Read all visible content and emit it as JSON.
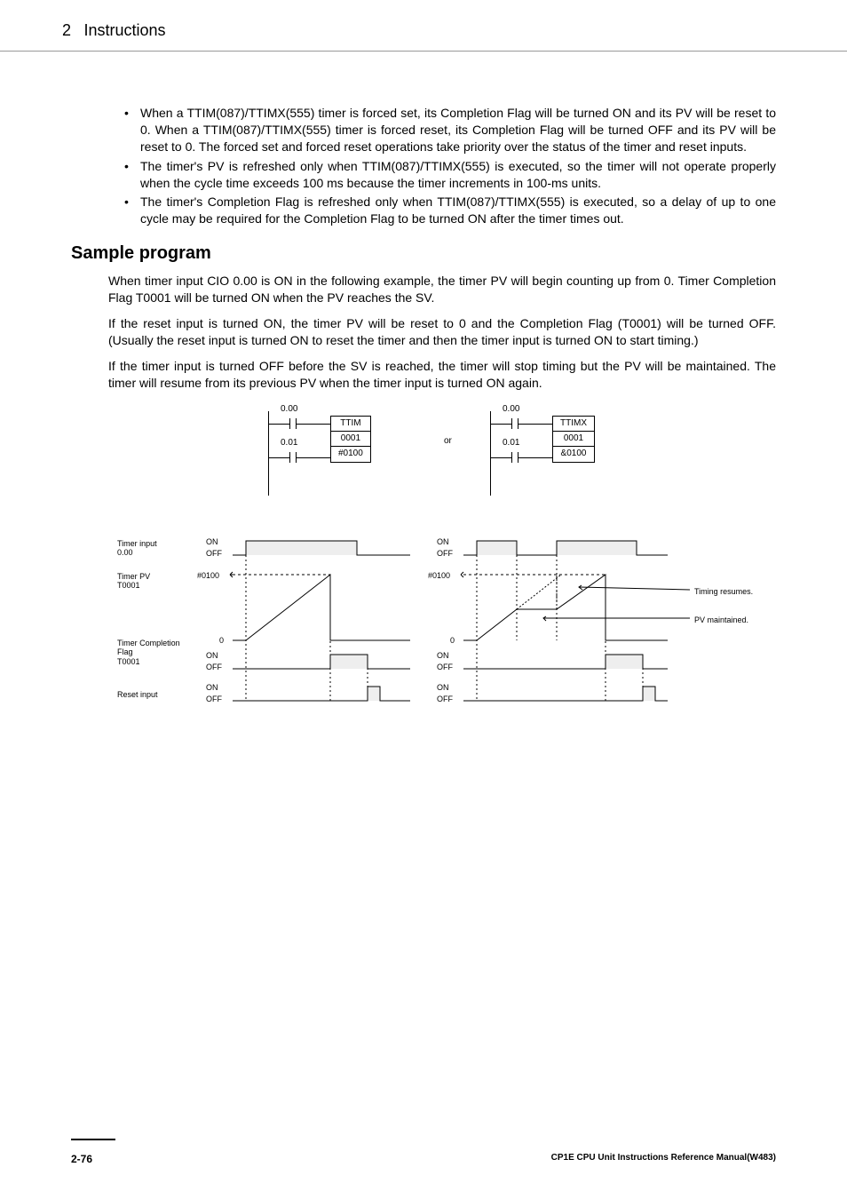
{
  "header": {
    "chapter": "2",
    "title": "Instructions"
  },
  "bullets": [
    "When a TTIM(087)/TTIMX(555) timer is forced set, its Completion Flag will be turned ON and its PV will be reset to 0. When a TTIM(087)/TTIMX(555) timer is forced reset, its Completion Flag will be turned OFF and its PV will be reset to 0. The forced set and forced reset operations take priority over the status of the timer and reset inputs.",
    "The timer's PV is refreshed only when TTIM(087)/TTIMX(555) is executed, so the timer will not operate properly when the cycle time exceeds 100 ms because the timer increments in 100-ms units.",
    "The timer's Completion Flag is refreshed only when TTIM(087)/TTIMX(555) is executed, so a delay of up to one cycle may be required for the Completion Flag to be turned ON after the timer times out."
  ],
  "section_heading": "Sample program",
  "paras": [
    "When timer input CIO 0.00 is ON in the following example, the timer PV will begin counting up from 0. Timer Completion Flag T0001 will be turned ON when the PV reaches the SV.",
    "If the reset input is turned ON, the timer PV will be reset to 0 and the Completion Flag (T0001) will be turned OFF. (Usually the reset input is turned ON to reset the timer and then the timer input is turned ON to start timing.)",
    "If the timer input is turned OFF before the SV is reached, the timer will stop timing but the PV will be maintained. The timer will resume from its previous PV when the timer input is turned ON again."
  ],
  "ladder": {
    "left": {
      "input1": "0.00",
      "input2": "0.01",
      "block": [
        "TTIM",
        "0001",
        "#0100"
      ]
    },
    "or": "or",
    "right": {
      "input1": "0.00",
      "input2": "0.01",
      "block": [
        "TTIMX",
        "0001",
        "&0100"
      ]
    }
  },
  "timing": {
    "labels": {
      "timer_input": "Timer input\n0.00",
      "timer_pv": "Timer PV\nT0001",
      "timer_cf": "Timer Completion\nFlag\nT0001",
      "reset": "Reset input",
      "on": "ON",
      "off": "OFF",
      "sv": "#0100",
      "zero": "0"
    },
    "ann": {
      "resumes": "Timing resumes.",
      "maintained": "PV maintained."
    }
  },
  "footer": {
    "page": "2-76",
    "title": "CP1E CPU Unit Instructions Reference Manual(W483)"
  }
}
